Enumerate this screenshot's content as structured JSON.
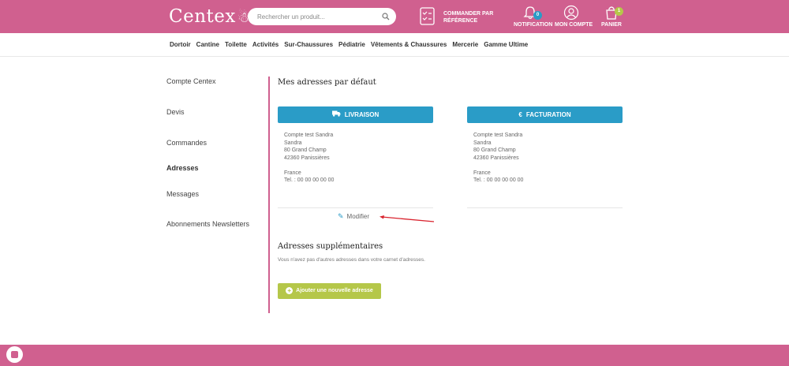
{
  "header": {
    "logo": "Centex",
    "search_placeholder": "Rechercher un produit...",
    "order_ref_line1": "COMMANDER PAR",
    "order_ref_line2": "RÉFÉRENCE",
    "notification_label": "NOTIFICATION",
    "notification_count": "0",
    "account_label": "MON COMPTE",
    "cart_label": "PANIER",
    "cart_count": "1"
  },
  "categories": [
    "Dortoir",
    "Cantine",
    "Toilette",
    "Activités",
    "Sur-Chaussures",
    "Pédiatrie",
    "Vêtements & Chaussures",
    "Mercerie",
    "Gamme Ultime"
  ],
  "sidebar": {
    "items": [
      "Compte Centex",
      "Devis",
      "Commandes",
      "Adresses",
      "Messages",
      "Abonnements Newsletters"
    ]
  },
  "main": {
    "default_title": "Mes adresses par défaut",
    "delivery": {
      "button": "LIVRAISON",
      "lines": [
        "Compte test Sandra",
        "Sandra",
        "80 Grand Champ",
        "42360 Panissières",
        "",
        "France",
        "Tel. : 00 00 00 00 00"
      ]
    },
    "billing": {
      "button": "FACTURATION",
      "lines": [
        "Compte test Sandra",
        "Sandra",
        "80 Grand Champ",
        "42360 Panissières",
        "",
        "France",
        "Tel. : 00 00 00 00 00"
      ]
    },
    "modify_label": "Modifier",
    "extra_title": "Adresses supplémentaires",
    "extra_empty": "Vous n'avez pas d'autres adresses dans votre carnet d'adresses.",
    "add_button": "Ajouter une nouvelle adresse"
  },
  "colors": {
    "brand_pink": "#d0608f",
    "accent_blue": "#2a9cc7",
    "accent_green": "#b5c749",
    "annotation_red": "#d9232e"
  },
  "icons": [
    "search-icon",
    "checklist-icon",
    "bell-icon",
    "user-icon",
    "bag-icon",
    "truck-icon",
    "euro-icon",
    "edit-icon",
    "plus-circle-icon",
    "chat-icon"
  ]
}
